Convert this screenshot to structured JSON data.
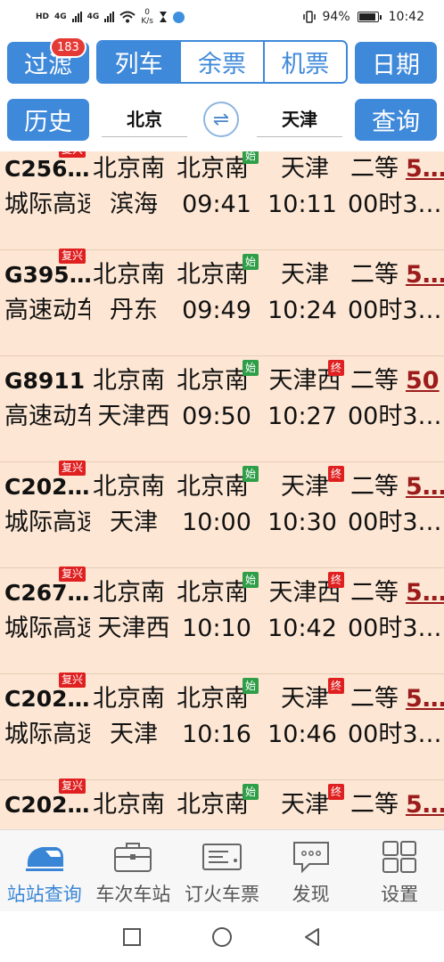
{
  "status_bar": {
    "network_tag": "HD",
    "sim1": "4G",
    "sim2": "4G",
    "speed_value": "0",
    "speed_unit": "K/s",
    "battery": "94%",
    "time": "10:42"
  },
  "toolbar": {
    "filter_label": "过滤",
    "filter_count": "183",
    "tabs": [
      "列车",
      "余票",
      "机票"
    ],
    "date_label": "日期"
  },
  "search": {
    "history_label": "历史",
    "from_station": "北京",
    "to_station": "天津",
    "swap_icon": "⇌",
    "query_label": "查询"
  },
  "trains": [
    {
      "train": "C256…",
      "tag": "复兴",
      "from": "北京南",
      "start": "北京南",
      "start_tag": "始",
      "to": "天津",
      "to_tag": "",
      "seat": "二等",
      "price": "5…",
      "type": "城际高速",
      "via": "滨海",
      "dep": "09:41",
      "arr": "10:11",
      "dur": "00时3…"
    },
    {
      "train": "G395…",
      "tag": "复兴",
      "from": "北京南",
      "start": "北京南",
      "start_tag": "始",
      "to": "天津",
      "to_tag": "",
      "seat": "二等",
      "price": "5…",
      "type": "高速动车",
      "via": "丹东",
      "dep": "09:49",
      "arr": "10:24",
      "dur": "00时3…"
    },
    {
      "train": "G8911",
      "tag": "",
      "from": "北京南",
      "start": "北京南",
      "start_tag": "始",
      "to": "天津西",
      "to_tag": "终",
      "seat": "二等",
      "price": "50",
      "type": "高速动车",
      "via": "天津西",
      "dep": "09:50",
      "arr": "10:27",
      "dur": "00时3…"
    },
    {
      "train": "C202…",
      "tag": "复兴",
      "from": "北京南",
      "start": "北京南",
      "start_tag": "始",
      "to": "天津",
      "to_tag": "终",
      "seat": "二等",
      "price": "5…",
      "type": "城际高速",
      "via": "天津",
      "dep": "10:00",
      "arr": "10:30",
      "dur": "00时3…"
    },
    {
      "train": "C267…",
      "tag": "复兴",
      "from": "北京南",
      "start": "北京南",
      "start_tag": "始",
      "to": "天津西",
      "to_tag": "终",
      "seat": "二等",
      "price": "5…",
      "type": "城际高速",
      "via": "天津西",
      "dep": "10:10",
      "arr": "10:42",
      "dur": "00时3…"
    },
    {
      "train": "C202…",
      "tag": "复兴",
      "from": "北京南",
      "start": "北京南",
      "start_tag": "始",
      "to": "天津",
      "to_tag": "终",
      "seat": "二等",
      "price": "5…",
      "type": "城际高速",
      "via": "天津",
      "dep": "10:16",
      "arr": "10:46",
      "dur": "00时3…"
    },
    {
      "train": "C202…",
      "tag": "复兴",
      "from": "北京南",
      "start": "北京南",
      "start_tag": "始",
      "to": "天津",
      "to_tag": "终",
      "seat": "二等",
      "price": "5…",
      "type": "",
      "via": "",
      "dep": "",
      "arr": "",
      "dur": ""
    }
  ],
  "bottom_nav": [
    {
      "label": "站站查询",
      "icon": "train-icon"
    },
    {
      "label": "车次车站",
      "icon": "briefcase-icon"
    },
    {
      "label": "订火车票",
      "icon": "ticket-icon"
    },
    {
      "label": "发现",
      "icon": "chat-bubble-icon"
    },
    {
      "label": "设置",
      "icon": "grid-icon"
    }
  ],
  "colors": {
    "accent": "#3f89da",
    "row_bg": "#fde7d4",
    "badge": "#e53935",
    "price": "#9c1c1c",
    "start_tag": "#2e9e48",
    "end_tag": "#e02020"
  }
}
